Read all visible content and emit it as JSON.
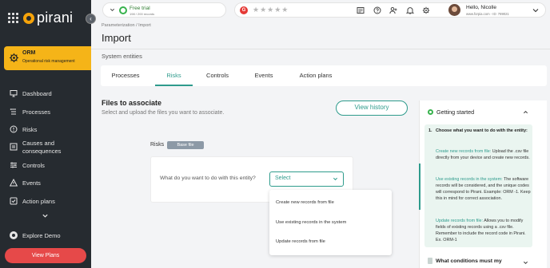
{
  "brand": {
    "name": "pirani",
    "accent": "#f5a30a"
  },
  "sidebar": {
    "module": {
      "title": "ORM",
      "subtitle": "Operational risk management"
    },
    "items": [
      {
        "label": "Dashboard",
        "icon": "monitor-icon"
      },
      {
        "label": "Processes",
        "icon": "processes-icon"
      },
      {
        "label": "Risks",
        "icon": "alert-circle-icon"
      },
      {
        "label": "Causes and consequences",
        "icon": "causes-icon"
      },
      {
        "label": "Controls",
        "icon": "sliders-icon"
      },
      {
        "label": "Events",
        "icon": "warning-triangle-icon"
      },
      {
        "label": "Action plans",
        "icon": "checkbox-icon"
      }
    ],
    "explore_label": "Explore Demo",
    "view_plans_label": "View Plans"
  },
  "topbar": {
    "trial_title": "Free trial",
    "trial_sub": "198 / 200 records",
    "stars": "★★★★★",
    "user_greeting": "Hello, Nicolle",
    "user_meta": "www.forpia.com - ID: 789021"
  },
  "breadcrumb": "Parameterization / Import",
  "page_title": "Import",
  "section_label": "System entities",
  "tabs": [
    {
      "label": "Processes"
    },
    {
      "label": "Risks"
    },
    {
      "label": "Controls"
    },
    {
      "label": "Events"
    },
    {
      "label": "Action plans"
    }
  ],
  "active_tab": "Risks",
  "files": {
    "title": "Files to associate",
    "subtitle": "Select and upload the files you want to associate.",
    "history_label": "View history"
  },
  "entity": {
    "label": "Risks",
    "badge": "Base file",
    "question": "What do you want to do with this entity?",
    "select_value": "Select",
    "options": [
      "Create new records from file",
      "Use existing records in the system",
      "Update records from file"
    ]
  },
  "getting_started": {
    "title": "Getting started",
    "step_number": "1.",
    "step_title": "Choose what you want to do with the entity:",
    "items": [
      {
        "highlight": "Create new records from file:",
        "text": " Upload the .csv file directly from your device and create new records."
      },
      {
        "highlight": "Use existing records in the system:",
        "text": " The software records will be considered, and the unique codes will correspond to Pirani. Example: ORM -1. Keep this in mind for correct association."
      },
      {
        "highlight": "Update records from file:",
        "text": " Allows you to modify fields of existing records using a .csv file. Remember to include the record code in Pirani. Ex. ORM-1"
      }
    ],
    "next_section": "What conditions must my"
  },
  "colors": {
    "sidebar_bg": "#262b30",
    "teal": "#2e9b8c",
    "orm_yellow": "#f5b418",
    "view_plans_red": "#e64949",
    "trial_green": "#37b24d"
  }
}
